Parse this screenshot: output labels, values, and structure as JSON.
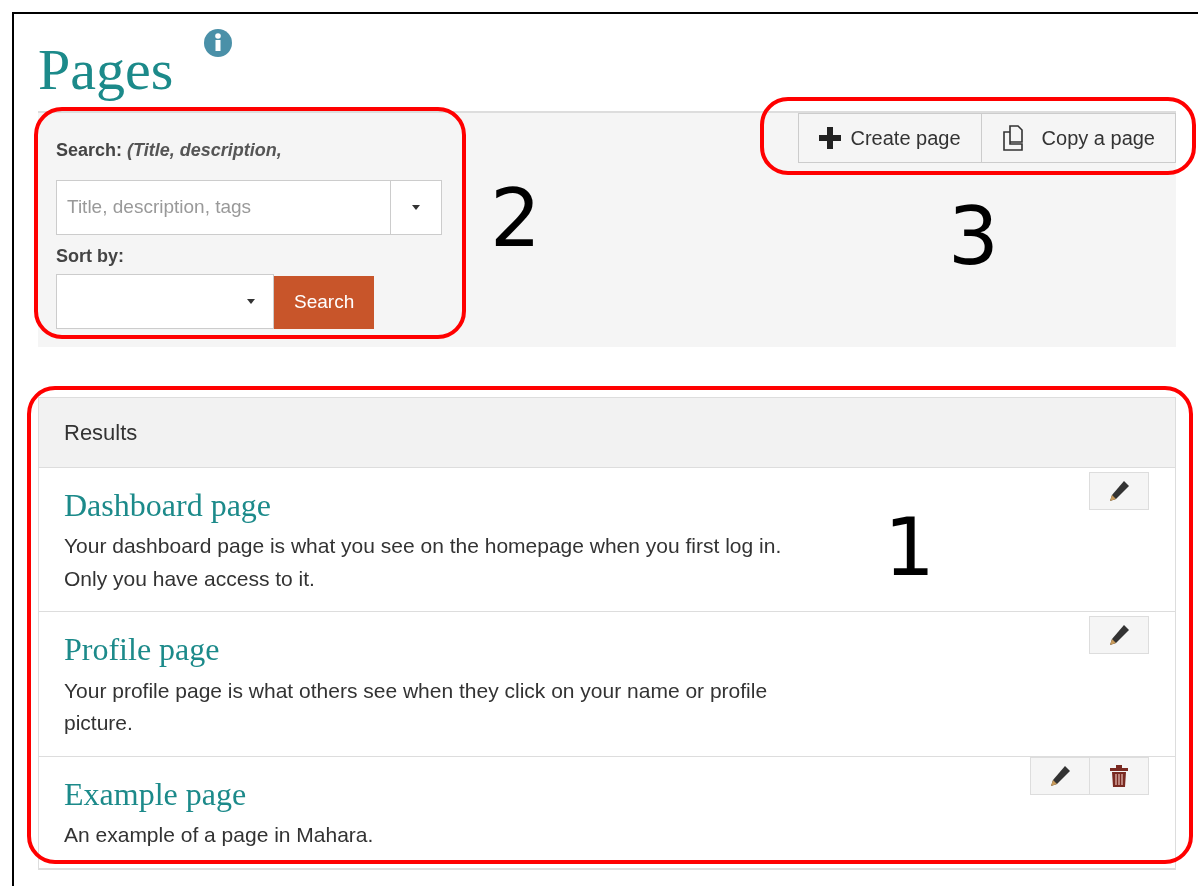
{
  "page": {
    "title": "Pages",
    "info": true
  },
  "search": {
    "label": "Search:",
    "hint": "(Title, description,",
    "placeholder": "Title, description, tags",
    "sort_label": "Sort by:",
    "button": "Search",
    "callout": "2"
  },
  "actions": {
    "buttons": [
      {
        "kind": "create",
        "label": "Create page"
      },
      {
        "kind": "copy",
        "label": "Copy a page"
      }
    ],
    "callout": "3"
  },
  "results": {
    "heading": "Results",
    "callout": "1",
    "rows": [
      {
        "title": "Dashboard page",
        "description": "Your dashboard page is what you see on the homepage when you first log in. Only you have access to it.",
        "actions": [
          {
            "kind": "edit"
          }
        ]
      },
      {
        "title": "Profile page",
        "description": "Your profile page is what others see when they click on your name or profile picture.",
        "actions": [
          {
            "kind": "edit"
          }
        ]
      },
      {
        "title": "Example page",
        "description": "An example of a page in Mahara.",
        "actions": [
          {
            "kind": "edit"
          },
          {
            "kind": "delete"
          }
        ]
      }
    ]
  }
}
